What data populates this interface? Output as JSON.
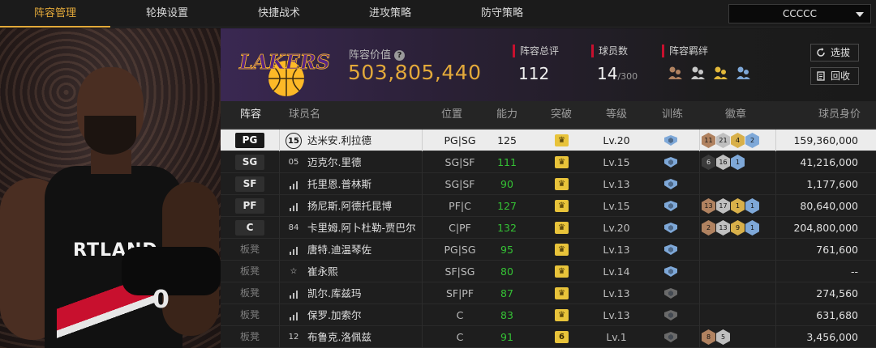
{
  "nav": {
    "tabs": [
      "阵容管理",
      "轮换设置",
      "快捷战术",
      "进攻策略",
      "防守策略"
    ],
    "active_tab": "阵容管理",
    "team_selector": "CCCCC"
  },
  "player_card": {
    "jersey_text": "RTLAND",
    "jersey_number": "0"
  },
  "summary": {
    "team_logo_text": "LAKERS",
    "lineup_value_label": "阵容价值",
    "lineup_value": "503,805,440",
    "overall_label": "阵容总评",
    "overall_value": "112",
    "player_count_label": "球员数",
    "player_count": "14",
    "player_count_max": "/300",
    "chemistry_label": "阵容羁绊",
    "buttons": {
      "pick": "选拔",
      "recycle": "回收"
    }
  },
  "table": {
    "headers": {
      "lineup": "阵容",
      "player_name": "球员名",
      "position": "位置",
      "ability": "能力",
      "breakthrough": "突破",
      "level": "等级",
      "training": "训练",
      "badges": "徽章",
      "player_value": "球员身价"
    },
    "rows": [
      {
        "slot": "PG",
        "bench": false,
        "jersey": "15",
        "name": "达米安.利拉德",
        "position": "PG|SG",
        "ability": "125",
        "break": "♛",
        "level": "Lv.20",
        "train": "blue",
        "badges": [
          {
            "n": "11",
            "c": "bronze"
          },
          {
            "n": "21",
            "c": "silver"
          },
          {
            "n": "4",
            "c": "gold"
          },
          {
            "n": "2",
            "c": "blue"
          }
        ],
        "value": "159,360,000",
        "selected": true
      },
      {
        "slot": "SG",
        "bench": false,
        "jersey": "05",
        "name": "迈克尔.里德",
        "position": "SG|SF",
        "ability": "111",
        "break": "♛",
        "level": "Lv.15",
        "train": "blue",
        "badges": [
          {
            "n": "6",
            "c": "dark"
          },
          {
            "n": "16",
            "c": "silver"
          },
          {
            "n": "1",
            "c": "blue"
          }
        ],
        "value": "41,216,000"
      },
      {
        "slot": "SF",
        "bench": false,
        "jersey": "",
        "name": "托里恩.普林斯",
        "position": "SG|SF",
        "ability": "90",
        "break": "♛",
        "level": "Lv.13",
        "train": "blue",
        "badges": [],
        "value": "1,177,600"
      },
      {
        "slot": "PF",
        "bench": false,
        "jersey": "",
        "name": "扬尼斯.阿德托昆博",
        "position": "PF|C",
        "ability": "127",
        "break": "♛",
        "level": "Lv.15",
        "train": "blue",
        "badges": [
          {
            "n": "13",
            "c": "bronze"
          },
          {
            "n": "17",
            "c": "silver"
          },
          {
            "n": "1",
            "c": "gold"
          },
          {
            "n": "1",
            "c": "blue"
          }
        ],
        "value": "80,640,000"
      },
      {
        "slot": "C",
        "bench": false,
        "jersey": "84",
        "name": "卡里姆.阿卜杜勒-贾巴尔",
        "position": "C|PF",
        "ability": "132",
        "break": "♛",
        "level": "Lv.20",
        "train": "blue",
        "badges": [
          {
            "n": "2",
            "c": "bronze"
          },
          {
            "n": "13",
            "c": "silver"
          },
          {
            "n": "9",
            "c": "gold"
          },
          {
            "n": "1",
            "c": "blue"
          }
        ],
        "value": "204,800,000"
      },
      {
        "slot": "板凳",
        "bench": true,
        "jersey": "",
        "name": "唐特.迪温琴佐",
        "position": "PG|SG",
        "ability": "95",
        "break": "♛",
        "level": "Lv.13",
        "train": "blue",
        "badges": [],
        "value": "761,600"
      },
      {
        "slot": "板凳",
        "bench": true,
        "jersey": "☆",
        "name": "崔永熙",
        "position": "SF|SG",
        "ability": "80",
        "break": "♛",
        "level": "Lv.14",
        "train": "blue",
        "badges": [],
        "value": "--"
      },
      {
        "slot": "板凳",
        "bench": true,
        "jersey": "",
        "name": "凯尔.库兹玛",
        "position": "SF|PF",
        "ability": "87",
        "break": "♛",
        "level": "Lv.13",
        "train": "grey",
        "badges": [],
        "value": "274,560"
      },
      {
        "slot": "板凳",
        "bench": true,
        "jersey": "",
        "name": "保罗.加索尔",
        "position": "C",
        "ability": "83",
        "break": "♛",
        "level": "Lv.13",
        "train": "grey",
        "badges": [],
        "value": "631,680"
      },
      {
        "slot": "板凳",
        "bench": true,
        "jersey": "12",
        "name": "布鲁克.洛佩兹",
        "position": "C",
        "ability": "91",
        "break": "6",
        "level": "Lv.1",
        "train": "grey",
        "badges": [
          {
            "n": "8",
            "c": "bronze"
          },
          {
            "n": "5",
            "c": "silver"
          }
        ],
        "value": "3,456,000"
      }
    ]
  },
  "colors": {
    "accent": "#e3a93a",
    "ability_green": "#35c235",
    "lakers_purple": "#552583",
    "lakers_gold": "#fdb927"
  }
}
